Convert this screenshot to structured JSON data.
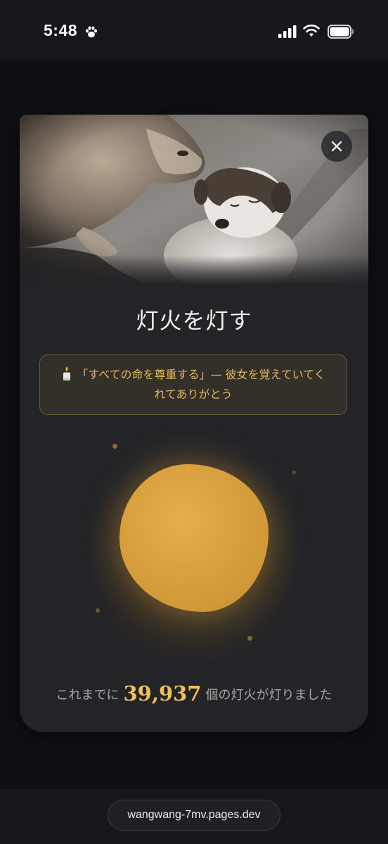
{
  "status_bar": {
    "time": "5:48",
    "icons": [
      "paw-icon",
      "signal-icon",
      "wifi-icon",
      "battery-icon"
    ]
  },
  "modal": {
    "hero_image": "cat-and-puppy-photo",
    "close_icon": "close-icon",
    "title": "灯火を灯す",
    "message_icon": "candle-icon",
    "message": "「すべての命を尊重する」— 彼女を覚えていてくれてありがとう",
    "orb_color": "#d9a03e",
    "count_prefix": "これまでに",
    "count_value": "39,937",
    "count_suffix": "個の灯火が灯りました"
  },
  "browser": {
    "url": "wangwang-7mv.pages.dev"
  },
  "colors": {
    "accent_gold": "#e6b65a",
    "number_gold": "#f0be5c",
    "modal_bg": "#232427",
    "page_bg": "#101114"
  }
}
